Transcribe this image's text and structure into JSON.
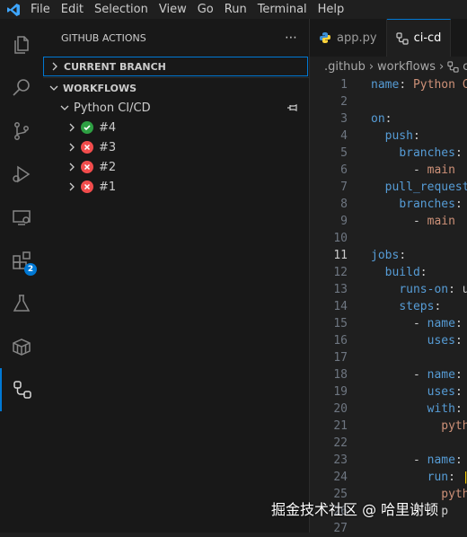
{
  "menu": [
    "File",
    "Edit",
    "Selection",
    "View",
    "Go",
    "Run",
    "Terminal",
    "Help"
  ],
  "sidebar": {
    "title": "GITHUB ACTIONS",
    "more": "⋯",
    "current_branch": "CURRENT BRANCH",
    "workflows": "WORKFLOWS",
    "workflow_name": "Python CI/CD",
    "runs": [
      {
        "label": "#4",
        "status": "success"
      },
      {
        "label": "#3",
        "status": "failure"
      },
      {
        "label": "#2",
        "status": "failure"
      },
      {
        "label": "#1",
        "status": "failure"
      }
    ]
  },
  "activity": {
    "extensions_badge": "2"
  },
  "tabs": [
    {
      "label": "app.py",
      "active": false
    },
    {
      "label": "ci-cd",
      "active": true
    }
  ],
  "breadcrumb": [
    ".github",
    "workflows",
    "c"
  ],
  "code": {
    "current_line": 11,
    "lines": [
      [
        [
          "k",
          "name"
        ],
        [
          "p",
          ": "
        ],
        [
          "v",
          "Python C"
        ]
      ],
      [],
      [
        [
          "k",
          "on"
        ],
        [
          "p",
          ":"
        ]
      ],
      [
        [
          "p",
          "  "
        ],
        [
          "k",
          "push"
        ],
        [
          "p",
          ":"
        ]
      ],
      [
        [
          "p",
          "    "
        ],
        [
          "k",
          "branches"
        ],
        [
          "p",
          ": "
        ]
      ],
      [
        [
          "p",
          "      - "
        ],
        [
          "v",
          "main"
        ]
      ],
      [
        [
          "p",
          "  "
        ],
        [
          "k",
          "pull_request"
        ]
      ],
      [
        [
          "p",
          "    "
        ],
        [
          "k",
          "branches"
        ],
        [
          "p",
          ": "
        ]
      ],
      [
        [
          "p",
          "      - "
        ],
        [
          "v",
          "main"
        ]
      ],
      [],
      [
        [
          "k",
          "jobs"
        ],
        [
          "p",
          ":"
        ]
      ],
      [
        [
          "p",
          "  "
        ],
        [
          "k",
          "build"
        ],
        [
          "p",
          ":"
        ]
      ],
      [
        [
          "p",
          "    "
        ],
        [
          "k",
          "runs-on"
        ],
        [
          "p",
          ": u"
        ]
      ],
      [
        [
          "p",
          "    "
        ],
        [
          "k",
          "steps"
        ],
        [
          "p",
          ":"
        ]
      ],
      [
        [
          "p",
          "      - "
        ],
        [
          "k",
          "name"
        ],
        [
          "p",
          ":"
        ]
      ],
      [
        [
          "p",
          "        "
        ],
        [
          "k",
          "uses"
        ],
        [
          "p",
          ":"
        ]
      ],
      [],
      [
        [
          "p",
          "      - "
        ],
        [
          "k",
          "name"
        ],
        [
          "p",
          ":"
        ]
      ],
      [
        [
          "p",
          "        "
        ],
        [
          "k",
          "uses"
        ],
        [
          "p",
          ":"
        ]
      ],
      [
        [
          "p",
          "        "
        ],
        [
          "k",
          "with"
        ],
        [
          "p",
          ":"
        ]
      ],
      [
        [
          "p",
          "          "
        ],
        [
          "v",
          "pyth"
        ]
      ],
      [],
      [
        [
          "p",
          "      - "
        ],
        [
          "k",
          "name"
        ],
        [
          "p",
          ":"
        ]
      ],
      [
        [
          "p",
          "        "
        ],
        [
          "k",
          "run"
        ],
        [
          "p",
          ": "
        ],
        [
          "y",
          "|"
        ]
      ],
      [
        [
          "p",
          "          "
        ],
        [
          "v",
          "pyth"
        ]
      ],
      [
        [
          "p",
          "          p"
        ]
      ],
      []
    ]
  },
  "watermark": "掘金技术社区 @ 哈里谢顿",
  "colors": {
    "accent": "#0078d4",
    "success": "#2ea043",
    "failure": "#f14c4c",
    "key": "#569cd6",
    "string": "#ce9178"
  }
}
